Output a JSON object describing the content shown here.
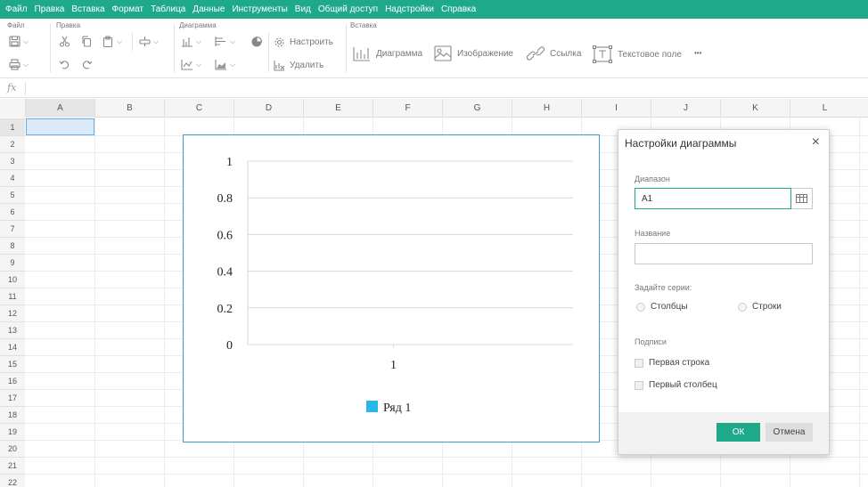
{
  "menu": [
    "Файл",
    "Правка",
    "Вставка",
    "Формат",
    "Таблица",
    "Данные",
    "Инструменты",
    "Вид",
    "Общий доступ",
    "Надстройки",
    "Справка"
  ],
  "toolbar": {
    "group_file": "Файл",
    "group_edit": "Правка",
    "group_chart": "Диаграмма",
    "group_insert": "Вставка",
    "configure_label": "Настроить",
    "delete_label": "Удалить",
    "insert_chart_label": "Диаграмма",
    "insert_image_label": "Изображение",
    "insert_link_label": "Ссылка",
    "insert_textbox_label": "Текстовое поле",
    "more_label": "•••"
  },
  "formula": {
    "fx": "fx",
    "value": ""
  },
  "columns": [
    "A",
    "B",
    "C",
    "D",
    "E",
    "F",
    "G",
    "H",
    "I",
    "J",
    "K",
    "L"
  ],
  "rows": [
    "1",
    "2",
    "3",
    "4",
    "5",
    "6",
    "7",
    "8",
    "9",
    "10",
    "11",
    "12",
    "13",
    "14",
    "15",
    "16",
    "17",
    "18",
    "19",
    "20",
    "21",
    "22"
  ],
  "selected_cell": "A1",
  "chart_data": {
    "type": "bar",
    "categories": [
      "1"
    ],
    "series": [
      {
        "name": "Ряд 1",
        "values": [
          0
        ],
        "color": "#29b6e8"
      }
    ],
    "ylim": [
      0,
      1
    ],
    "yticks": [
      "0",
      "0.2",
      "0.4",
      "0.6",
      "0.8",
      "1"
    ],
    "title": "",
    "xlabel": "",
    "ylabel": "",
    "legend": "bottom",
    "grid": true
  },
  "dialog": {
    "title": "Настройки диаграммы",
    "range_label": "Диапазон",
    "range_value": "A1",
    "name_label": "Название",
    "name_value": "",
    "series_label": "Задайте серии:",
    "columns_option": "Столбцы",
    "rows_option": "Строки",
    "captions_label": "Подписи",
    "first_row": "Первая строка",
    "first_column": "Первый столбец",
    "ok": "ОК",
    "cancel": "Отмена"
  },
  "colors": {
    "accent": "#1fa98b",
    "chart_border": "#3f9bd8",
    "series": "#29b6e8"
  }
}
